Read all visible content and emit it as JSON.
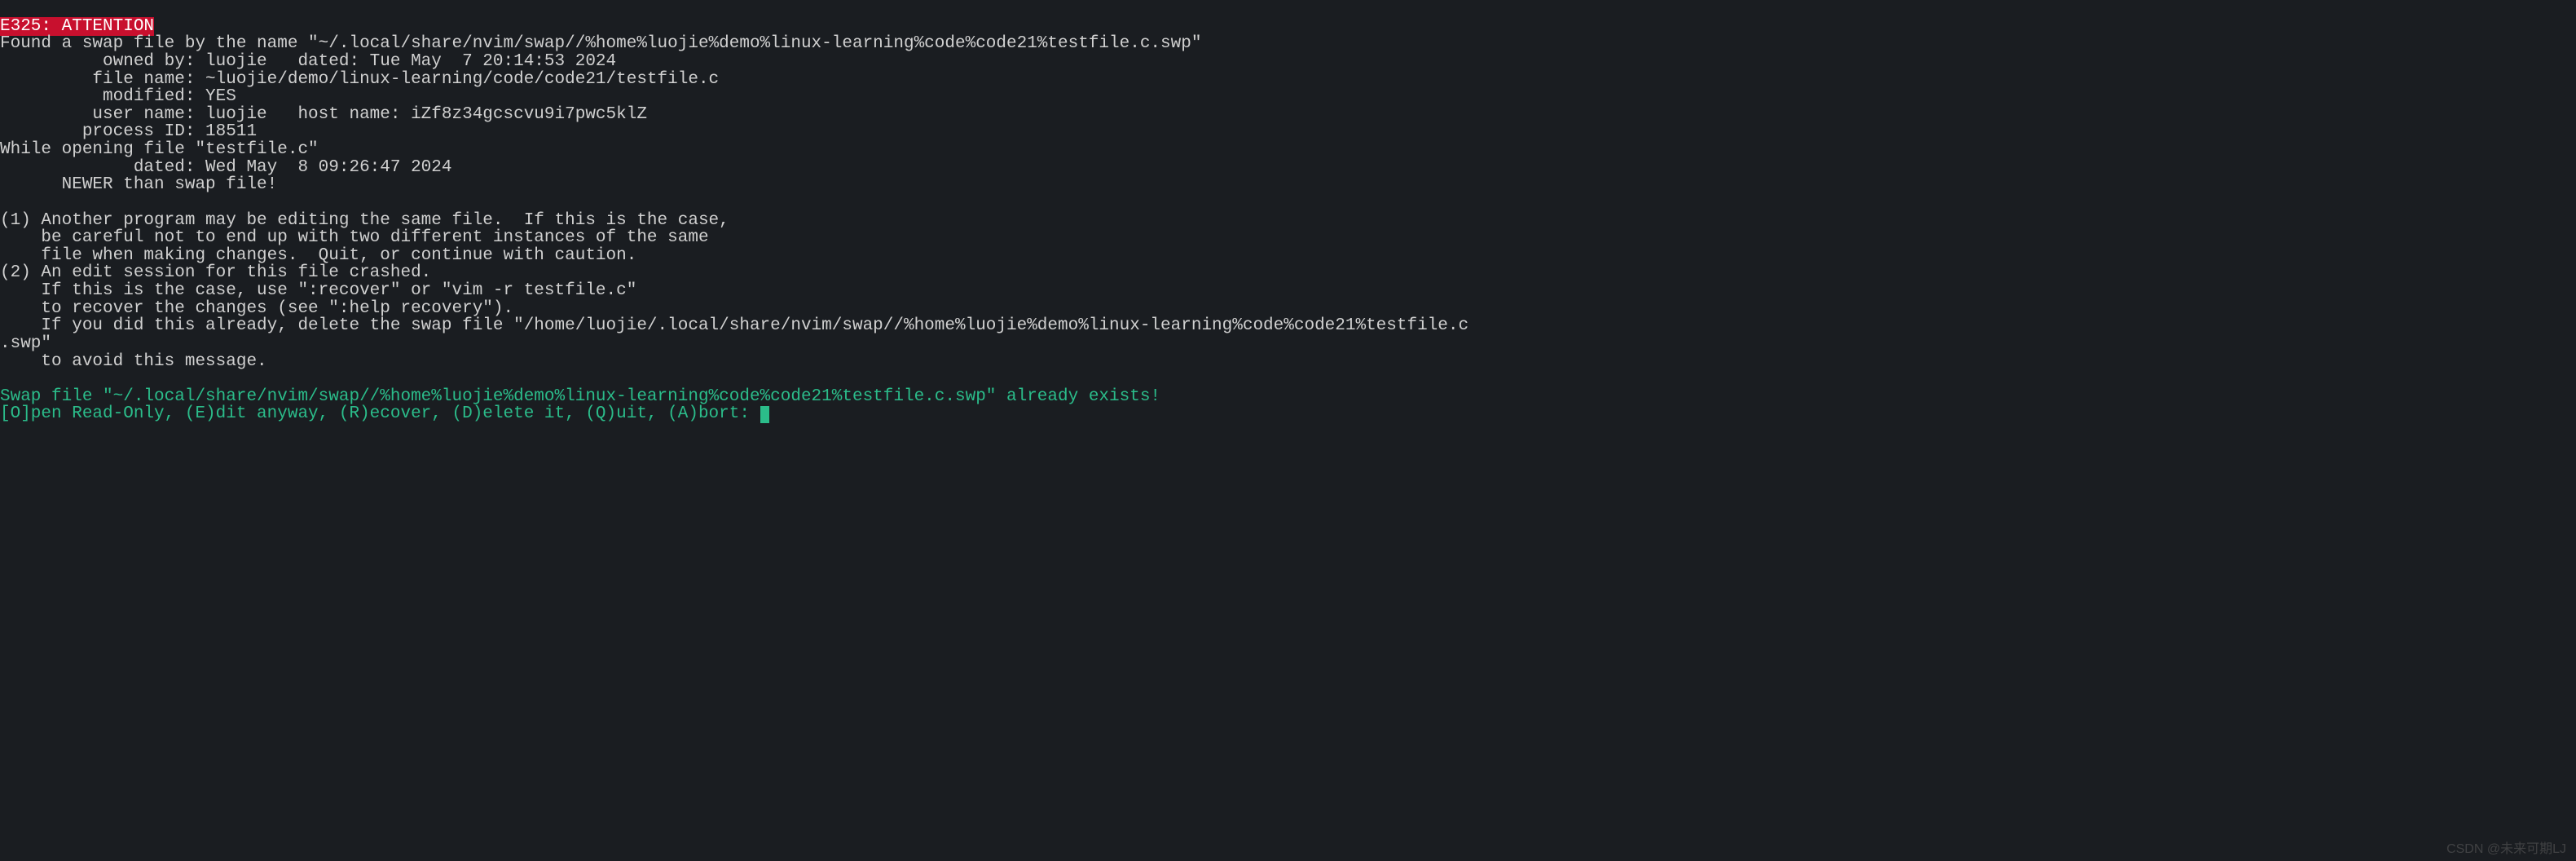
{
  "error_header": "E325: ATTENTION",
  "found_line": "Found a swap file by the name \"~/.local/share/nvim/swap//%home%luojie%demo%linux-learning%code%code21%testfile.c.swp\"",
  "owned_by": "          owned by: luojie   dated: Tue May  7 20:14:53 2024",
  "file_name": "         file name: ~luojie/demo/linux-learning/code/code21/testfile.c",
  "modified": "          modified: YES",
  "user_name": "         user name: luojie   host name: iZf8z34gcscvu9i7pwc5klZ",
  "process_id": "        process ID: 18511",
  "while_opening": "While opening file \"testfile.c\"",
  "dated2": "             dated: Wed May  8 09:26:47 2024",
  "newer": "      NEWER than swap file!",
  "blank1": "",
  "opt1_l1": "(1) Another program may be editing the same file.  If this is the case,",
  "opt1_l2": "    be careful not to end up with two different instances of the same",
  "opt1_l3": "    file when making changes.  Quit, or continue with caution.",
  "opt2_l1": "(2) An edit session for this file crashed.",
  "opt2_l2": "    If this is the case, use \":recover\" or \"vim -r testfile.c\"",
  "opt2_l3": "    to recover the changes (see \":help recovery\").",
  "opt2_l4": "    If you did this already, delete the swap file \"/home/luojie/.local/share/nvim/swap//%home%luojie%demo%linux-learning%code%code21%testfile.c",
  "opt2_l5": ".swp\"",
  "opt2_l6": "    to avoid this message.",
  "blank2": "",
  "swap_exists": "Swap file \"~/.local/share/nvim/swap//%home%luojie%demo%linux-learning%code%code21%testfile.c.swp\" already exists!",
  "prompt": "[O]pen Read-Only, (E)dit anyway, (R)ecover, (D)elete it, (Q)uit, (A)bort: ",
  "watermark": "CSDN @未来可期LJ"
}
